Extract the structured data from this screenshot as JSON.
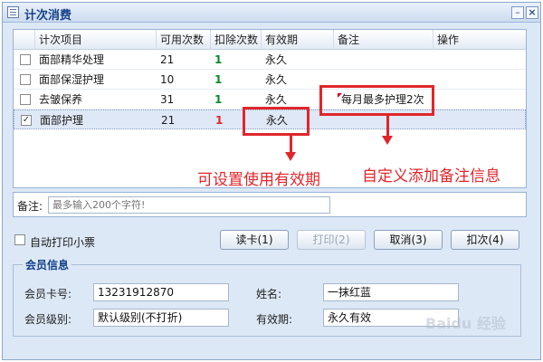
{
  "window": {
    "title": "计次消费",
    "min_symbol": "–",
    "close_symbol": "×"
  },
  "grid": {
    "columns": [
      "计次项目",
      "可用次数",
      "扣除次数",
      "有效期",
      "备注",
      "操作"
    ],
    "rows": [
      {
        "checked": false,
        "name": "面部精华处理",
        "available": "21",
        "deduct": "1",
        "validity": "永久",
        "note": "",
        "selected": false
      },
      {
        "checked": false,
        "name": "面部保湿护理",
        "available": "10",
        "deduct": "1",
        "validity": "永久",
        "note": "",
        "selected": false
      },
      {
        "checked": false,
        "name": "去皱保养",
        "available": "31",
        "deduct": "1",
        "validity": "永久",
        "note": "每月最多护理2次",
        "selected": false
      },
      {
        "checked": true,
        "name": "面部护理",
        "available": "21",
        "deduct": "1",
        "validity": "永久",
        "note": "",
        "selected": true
      }
    ],
    "check_mark": "✓"
  },
  "annotations": {
    "validity_text": "可设置使用有效期",
    "note_text": "自定义添加备注信息",
    "color": "#e0262b"
  },
  "remark": {
    "label": "备注:",
    "placeholder": "最多输入200个字符!"
  },
  "auto_print_label": "自动打印小票",
  "buttons": {
    "read_card": "读卡(1)",
    "print": "打印(2)",
    "cancel": "取消(3)",
    "deduct": "扣次(4)"
  },
  "member": {
    "legend": "会员信息",
    "card_label": "会员卡号:",
    "card_value": "13231912870",
    "name_label": "姓名:",
    "name_value": "一抹红蓝",
    "level_label": "会员级别:",
    "level_value": "默认级别(不打折)",
    "expiry_label": "有效期:",
    "expiry_value": "永久有效"
  },
  "watermark": "Baidu 经验"
}
